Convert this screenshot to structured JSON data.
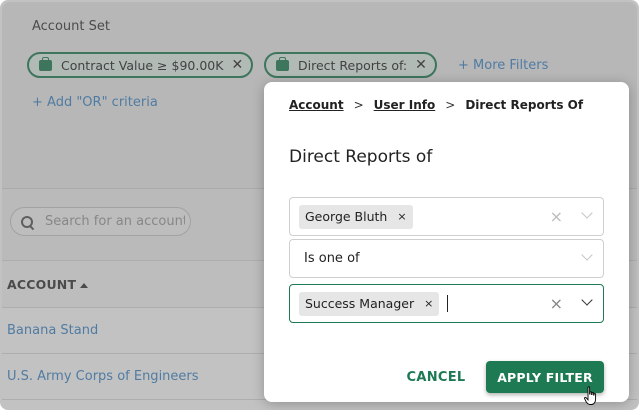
{
  "filter_panel": {
    "title": "Account Set",
    "chips": [
      {
        "label": "Contract Value ≥ $90.00K",
        "icon": "briefcase-icon",
        "remove_icon": "close-icon"
      },
      {
        "label": "Direct Reports of:",
        "icon": "briefcase-icon",
        "remove_icon": "close-icon"
      }
    ],
    "more_filters": "+ More Filters",
    "add_or": "+ Add \"OR\" criteria"
  },
  "search": {
    "placeholder": "Search for an account",
    "icon": "search-icon"
  },
  "table": {
    "header": "ACCOUNT",
    "sort_icon": "sort-ascending-icon",
    "rows": [
      "Banana Stand",
      "U.S. Army Corps of Engineers"
    ]
  },
  "dialog": {
    "breadcrumbs": {
      "items": [
        "Account",
        "User Info"
      ],
      "current": "Direct Reports Of",
      "separator": ">"
    },
    "title": "Direct Reports of",
    "user_select": {
      "tag": "George Bluth",
      "tag_remove": "×",
      "clear": "×"
    },
    "operator_select": {
      "value": "Is one of"
    },
    "role_select": {
      "tag": "Success Manager",
      "tag_remove": "×",
      "clear": "×"
    },
    "cancel_label": "CANCEL",
    "apply_label": "APPLY FILTER"
  },
  "colors": {
    "accent": "#1d7a52",
    "link": "#3b86c8",
    "overlay": "rgba(110,110,110,0.42)"
  }
}
